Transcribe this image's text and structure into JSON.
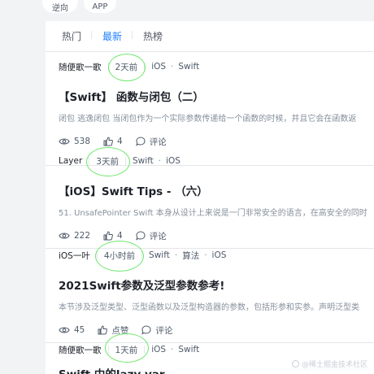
{
  "filter_chips": [
    "逆向",
    "APP"
  ],
  "tabs": [
    {
      "label": "热门",
      "active": false
    },
    {
      "label": "最新",
      "active": true
    },
    {
      "label": "热榜",
      "active": false
    }
  ],
  "articles": [
    {
      "author": "随便歌一歌",
      "time": "2天前",
      "tags": [
        "iOS",
        "Swift"
      ],
      "title": "【Swift】 函数与闭包（二）",
      "abstract": "闭包 逃逸闭包 当闭包作为一个实际参数传递给一个函数的时候，并且它会在函数返",
      "views": "538",
      "likes": "4",
      "comment_label": "评论"
    },
    {
      "author": "Layer",
      "time": "3天前",
      "tags": [
        "Swift",
        "iOS"
      ],
      "title": "【iOS】Swift Tips - （六）",
      "abstract": "51. UnsafePointer Swift 本身从设计上来说是一门非常安全的语言，在高安全的同时",
      "views": "222",
      "likes": "4",
      "comment_label": "评论"
    },
    {
      "author": "iOS一叶",
      "time": "4小时前",
      "tags": [
        "Swift",
        "算法",
        "iOS"
      ],
      "title": "2021Swift参数及泛型参数参考!",
      "abstract": "本节涉及泛型类型、泛型函数以及泛型构造器的参数，包括形参和实参。声明泛型类",
      "views": "45",
      "likes": "点赞",
      "comment_label": "评论"
    },
    {
      "author": "随便歌一歌",
      "time": "1天前",
      "tags": [
        "iOS",
        "Swift"
      ],
      "title": "Swift 中的lazy var"
    }
  ],
  "watermark": "@稀土掘金技术社区",
  "colors": {
    "accent": "#1e80ff",
    "annotation": "#6ee76a"
  }
}
